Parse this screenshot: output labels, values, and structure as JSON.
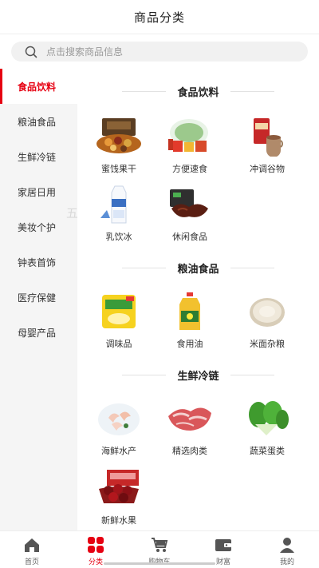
{
  "header": {
    "title": "商品分类"
  },
  "search": {
    "placeholder": "点击搜索商品信息"
  },
  "sidebar": {
    "items": [
      {
        "label": "食品饮料",
        "active": true
      },
      {
        "label": "粮油食品",
        "active": false
      },
      {
        "label": "生鲜冷链",
        "active": false
      },
      {
        "label": "家居日用",
        "active": false
      },
      {
        "label": "美妆个护",
        "active": false
      },
      {
        "label": "钟表首饰",
        "active": false
      },
      {
        "label": "医疗保健",
        "active": false
      },
      {
        "label": "母婴产品",
        "active": false
      }
    ]
  },
  "watermark": "五",
  "sections": [
    {
      "title": "食品饮料",
      "products": [
        {
          "label": "蜜饯果干",
          "icon": "dried-fruit-gift-box-icon"
        },
        {
          "label": "方便速食",
          "icon": "instant-food-icon"
        },
        {
          "label": "冲调谷物",
          "icon": "cereal-drink-icon"
        },
        {
          "label": "乳饮冰",
          "icon": "milk-carton-icon"
        },
        {
          "label": "休闲食品",
          "icon": "snack-meat-icon"
        }
      ]
    },
    {
      "title": "粮油食品",
      "products": [
        {
          "label": "调味品",
          "icon": "seasoning-bag-icon"
        },
        {
          "label": "食用油",
          "icon": "cooking-oil-bottle-icon"
        },
        {
          "label": "米面杂粮",
          "icon": "rice-bowl-icon"
        }
      ]
    },
    {
      "title": "生鲜冷链",
      "products": [
        {
          "label": "海鲜水产",
          "icon": "shrimp-plate-icon"
        },
        {
          "label": "精选肉类",
          "icon": "meat-slices-icon"
        },
        {
          "label": "蔬菜蛋类",
          "icon": "bok-choy-icon"
        },
        {
          "label": "新鲜水果",
          "icon": "cherries-box-icon"
        }
      ]
    }
  ],
  "tabbar": {
    "tabs": [
      {
        "label": "首页",
        "icon": "home-icon",
        "active": false
      },
      {
        "label": "分类",
        "icon": "category-grid-icon",
        "active": true
      },
      {
        "label": "购物车",
        "icon": "cart-icon",
        "active": false
      },
      {
        "label": "财富",
        "icon": "wallet-icon",
        "active": false
      },
      {
        "label": "我的",
        "icon": "user-icon",
        "active": false
      }
    ]
  },
  "colors": {
    "accent": "#e60012",
    "sidebar_bg": "#f5f5f5",
    "search_bg": "#f1f1f1"
  }
}
